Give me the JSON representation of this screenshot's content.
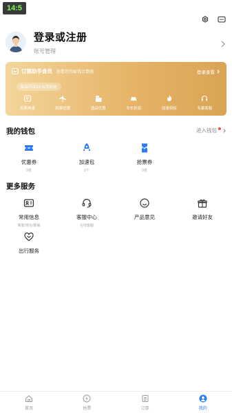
{
  "status": {
    "time": "14:5"
  },
  "profile": {
    "title": "登录或注册",
    "subtitle": "账号管理"
  },
  "vip": {
    "title": "订票助手会员",
    "desc": "查看您的省钱计算器",
    "upgrade": "登录查看",
    "pill": "最高可享9大会员权益",
    "perks": [
      {
        "label": "抢票神速",
        "icon": "ticket-fast-icon"
      },
      {
        "label": "机票优惠",
        "icon": "plane-icon"
      },
      {
        "label": "酒店优惠",
        "icon": "hotel-icon"
      },
      {
        "label": "专车折扣",
        "icon": "car-icon"
      },
      {
        "label": "加速特权",
        "icon": "flame-icon"
      },
      {
        "label": "专属客服",
        "icon": "headset-icon"
      }
    ]
  },
  "wallet": {
    "title": "我的钱包",
    "enter": "进入钱包",
    "items": [
      {
        "label": "优惠券",
        "sub": "0张",
        "icon": "coupon-icon"
      },
      {
        "label": "加速包",
        "sub": "0个",
        "icon": "rocket-icon"
      },
      {
        "label": "抢票券",
        "sub": "0张",
        "icon": "ticket-icon"
      }
    ]
  },
  "services": {
    "title": "更多服务",
    "items": [
      {
        "label": "常用信息",
        "sub": "乘客/地址/报销",
        "icon": "id-card-icon"
      },
      {
        "label": "客服中心",
        "sub": "在线客服",
        "icon": "headset-icon"
      },
      {
        "label": "产品意见",
        "sub": "",
        "icon": "smile-icon"
      },
      {
        "label": "邀请好友",
        "sub": "",
        "icon": "gift-icon"
      },
      {
        "label": "出行服务",
        "sub": "",
        "icon": "heart-icon"
      }
    ]
  },
  "tabbar": [
    {
      "label": "首页",
      "icon": "home-icon"
    },
    {
      "label": "抢票",
      "icon": "lightning-icon"
    },
    {
      "label": "订单",
      "icon": "order-icon"
    },
    {
      "label": "我的",
      "icon": "user-icon"
    }
  ],
  "colors": {
    "accent": "#2a7bf5",
    "gold_start": "#f4d59a",
    "gold_end": "#d9a454"
  }
}
